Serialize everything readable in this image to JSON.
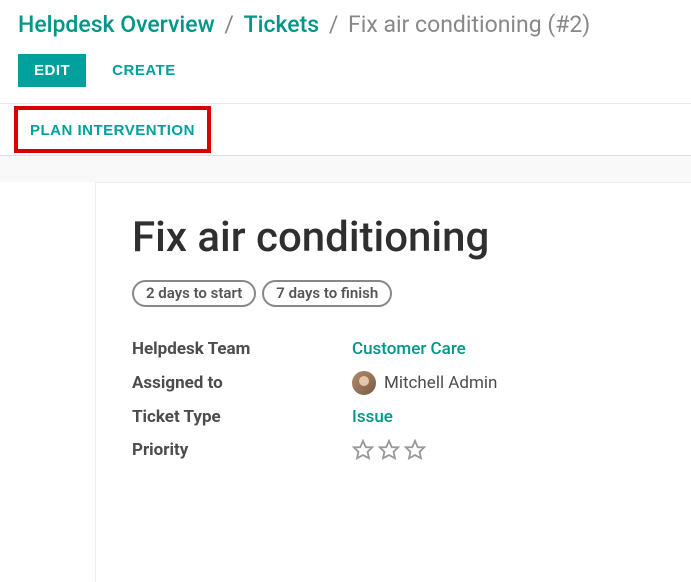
{
  "breadcrumb": {
    "overview": "Helpdesk Overview",
    "tickets": "Tickets",
    "current": "Fix air conditioning (#2)"
  },
  "actions": {
    "edit": "EDIT",
    "create": "CREATE",
    "plan_intervention": "PLAN INTERVENTION"
  },
  "ticket": {
    "title": "Fix air conditioning",
    "sla": {
      "start": "2 days to start",
      "finish": "7 days to finish"
    },
    "fields": {
      "team_label": "Helpdesk Team",
      "team_value": "Customer Care",
      "assigned_label": "Assigned to",
      "assigned_value": "Mitchell Admin",
      "type_label": "Ticket Type",
      "type_value": "Issue",
      "priority_label": "Priority"
    }
  },
  "colors": {
    "accent": "#00a09d",
    "highlight_border": "#d80000"
  }
}
